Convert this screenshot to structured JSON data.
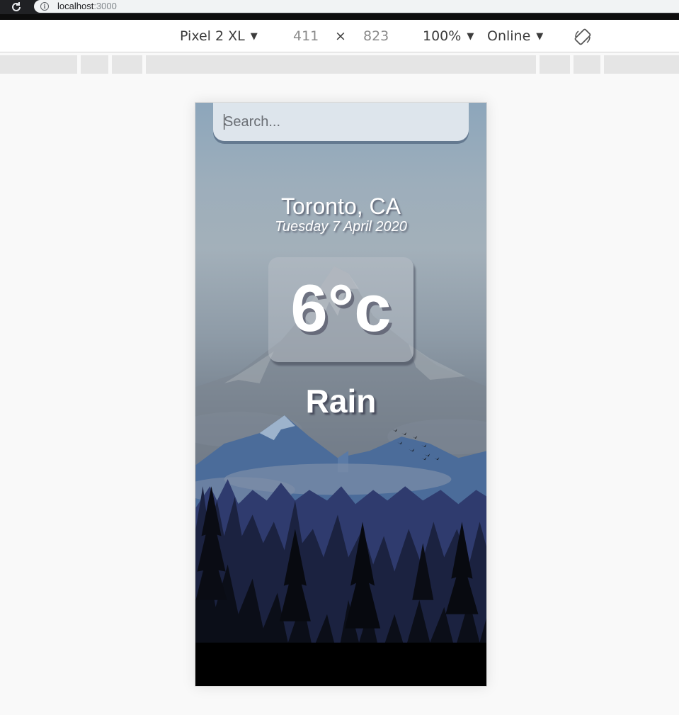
{
  "browser": {
    "url_host": "localhost",
    "url_port": ":3000"
  },
  "devtools": {
    "device": "Pixel 2 XL",
    "width": "411",
    "times": "×",
    "height": "823",
    "zoom": "100%",
    "network": "Online",
    "dropdown_glyph": "▼"
  },
  "app": {
    "search_placeholder": "Search...",
    "location": "Toronto, CA",
    "date": "Tuesday 7 April 2020",
    "temperature": "6°c",
    "condition": "Rain"
  },
  "icons": {
    "reload": "reload-icon",
    "info": "info-icon",
    "rotate": "rotate-icon"
  }
}
